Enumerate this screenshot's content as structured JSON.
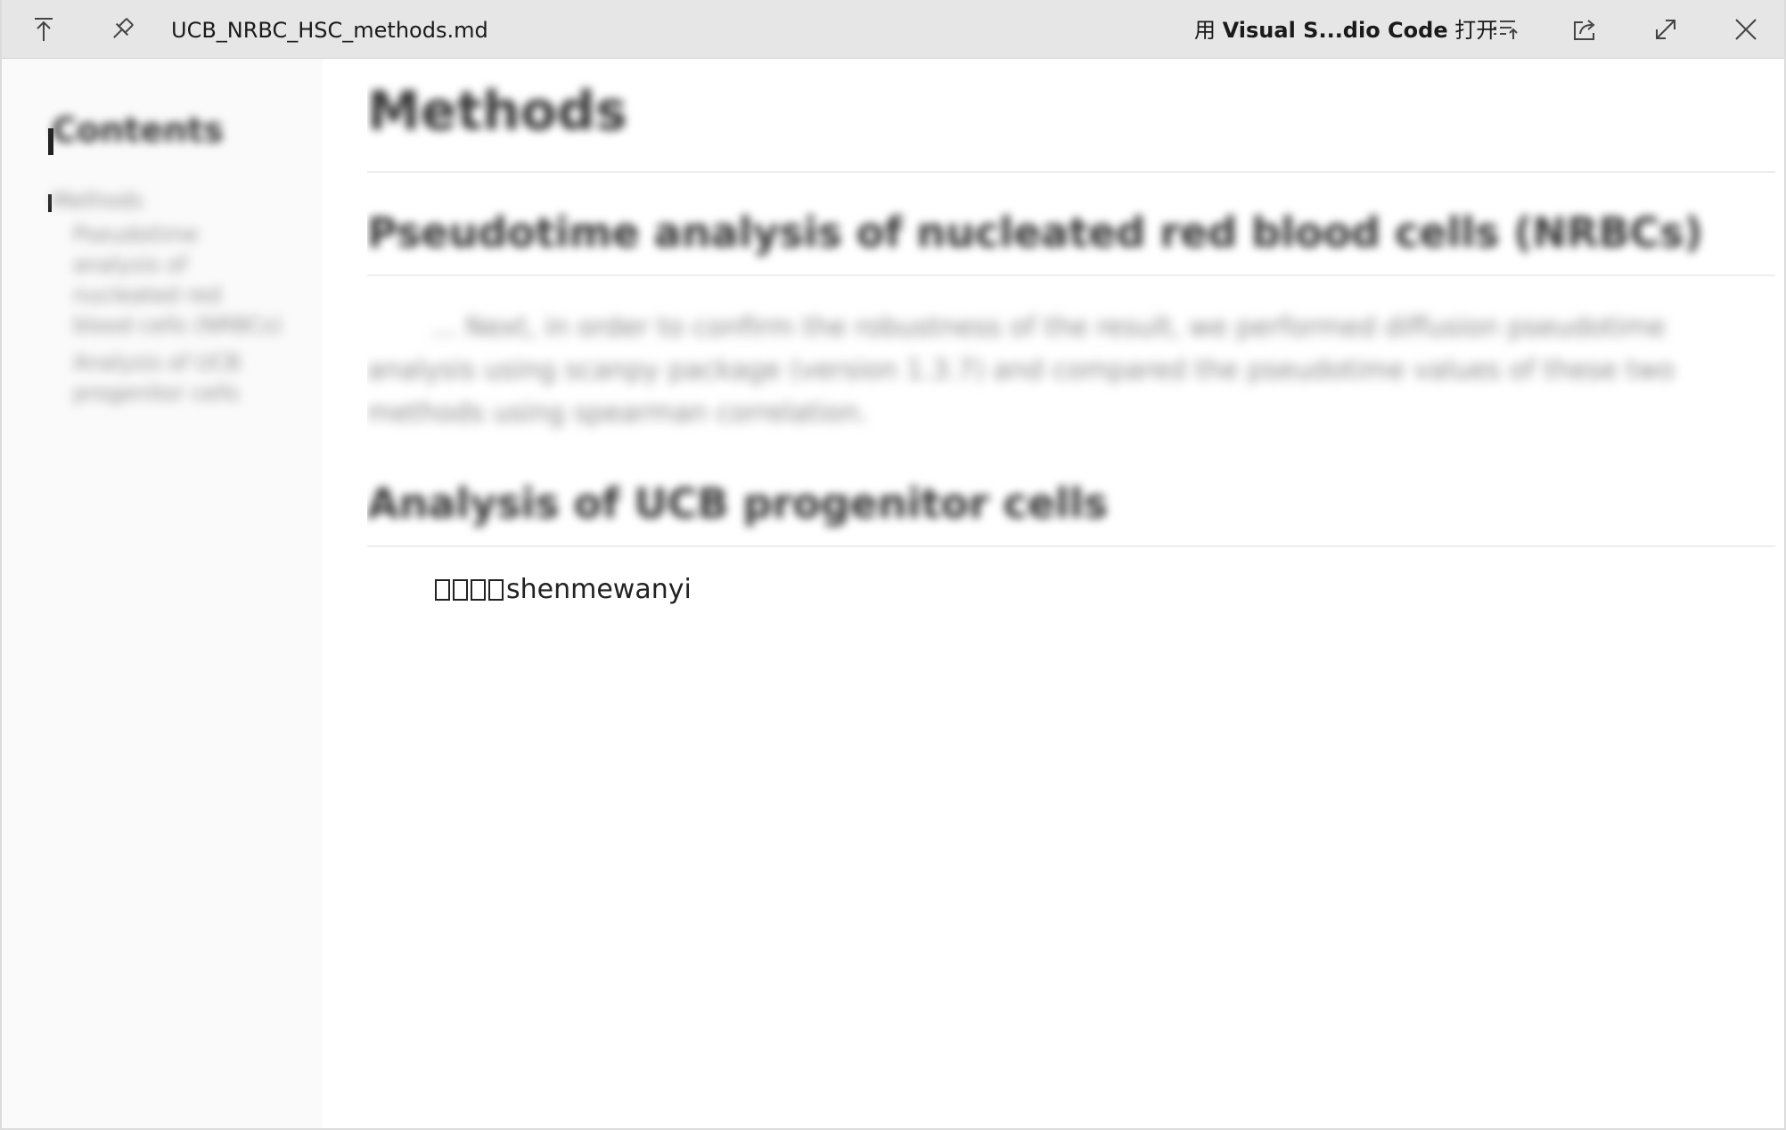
{
  "titlebar": {
    "file_name": "UCB_NRBC_HSC_methods.md",
    "open_with_prefix": "用 ",
    "open_with_app": "Visual S...dio Code",
    "open_with_suffix": " 打开",
    "icons": {
      "top": "arrow-to-top-icon",
      "pin": "pin-icon",
      "outline": "list-outline-icon",
      "share": "share-icon",
      "expand": "expand-icon",
      "close": "close-icon"
    }
  },
  "sidebar": {
    "title": "Contents",
    "items": [
      {
        "label": "Methods",
        "level": 1
      },
      {
        "label": "Pseudotime analysis of nucleated red blood cells (NRBCs)",
        "level": 2
      },
      {
        "label": "Analysis of UCB progenitor cells",
        "level": 2
      }
    ]
  },
  "document": {
    "title": "Methods",
    "sections": [
      {
        "heading": "Pseudotime analysis of nucleated red blood cells (NRBCs)",
        "body": "... Next, in order to confirm the robustness of the result, we performed diffusion pseudotime analysis using scanpy package (version 1.3.7) and compared the pseudotime values of these two methods using spearman correlation."
      },
      {
        "heading": "Analysis of UCB progenitor cells",
        "note_boxes": 4,
        "note_text": "shenmewanyi"
      }
    ]
  }
}
